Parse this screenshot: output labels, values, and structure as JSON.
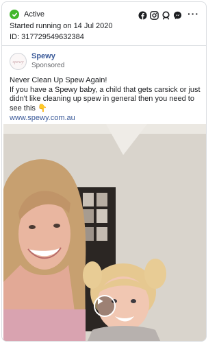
{
  "status": {
    "label": "Active",
    "started": "Started running on 14 Jul 2020",
    "id": "ID: 317729549632384"
  },
  "platforms": [
    "facebook-icon",
    "instagram-icon",
    "audience-network-icon",
    "messenger-icon"
  ],
  "more_label": "···",
  "ad": {
    "page_name": "Spewy",
    "sponsored": "Sponsored",
    "headline": "Never Clean Up Spew Again!",
    "body": "If you have a Spewy baby, a child that gets carsick or just didn't like cleaning up spew in general then you need to see this 👇",
    "link": "www.spewy.com.au"
  },
  "colors": {
    "active": "#42b72a",
    "link": "#385898",
    "border": "#dadde1"
  }
}
